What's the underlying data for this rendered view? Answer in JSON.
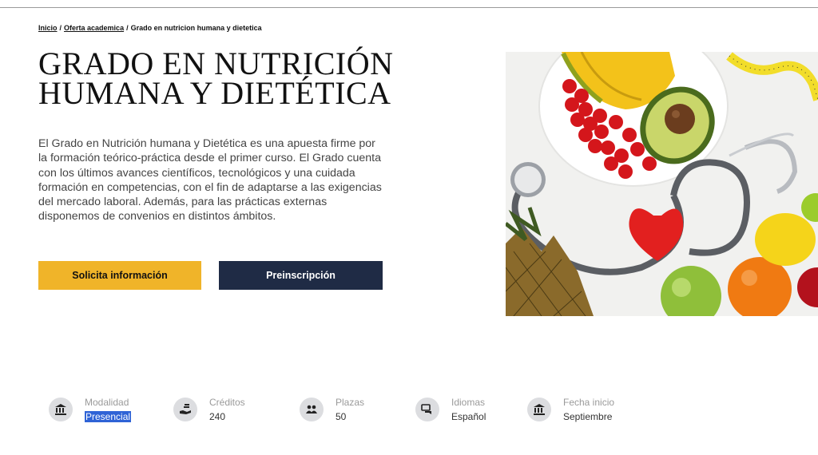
{
  "breadcrumb": {
    "items": [
      {
        "label": "Inicio"
      },
      {
        "label": "Oferta academica"
      },
      {
        "label": "Grado en nutricion humana y dietetica"
      }
    ],
    "separator": "/"
  },
  "hero": {
    "title_line1": "GRADO EN NUTRICIÓN",
    "title_line2": "HUMANA Y DIETÉTICA",
    "description": "El Grado en Nutrición humana y Dietética es una apuesta firme por la formación teórico-práctica desde el primer curso. El Grado cuenta con los últimos avances científicos, tecnológicos y una cuidada formación en competencias, con el fin de adaptarse a las exigencias del mercado laboral. Además, para las prácticas externas disponemos de convenios en distintos ámbitos.",
    "image_icon": "fruit-stethoscope-photo"
  },
  "buttons": {
    "info_label": "Solicita información",
    "preinscription_label": "Preinscripción"
  },
  "facts": [
    {
      "icon": "bank-icon",
      "label": "Modalidad",
      "value": "Presencial"
    },
    {
      "icon": "hand-coins-icon",
      "label": "Créditos",
      "value": "240"
    },
    {
      "icon": "people-icon",
      "label": "Plazas",
      "value": "50"
    },
    {
      "icon": "chat-icon",
      "label": "Idiomas",
      "value": "Español"
    },
    {
      "icon": "bank-icon",
      "label": "Fecha inicio",
      "value": "Septiembre"
    }
  ],
  "colors": {
    "accent_yellow": "#f0b429",
    "navy": "#1f2b45",
    "icon_bg": "#dcdde0"
  }
}
